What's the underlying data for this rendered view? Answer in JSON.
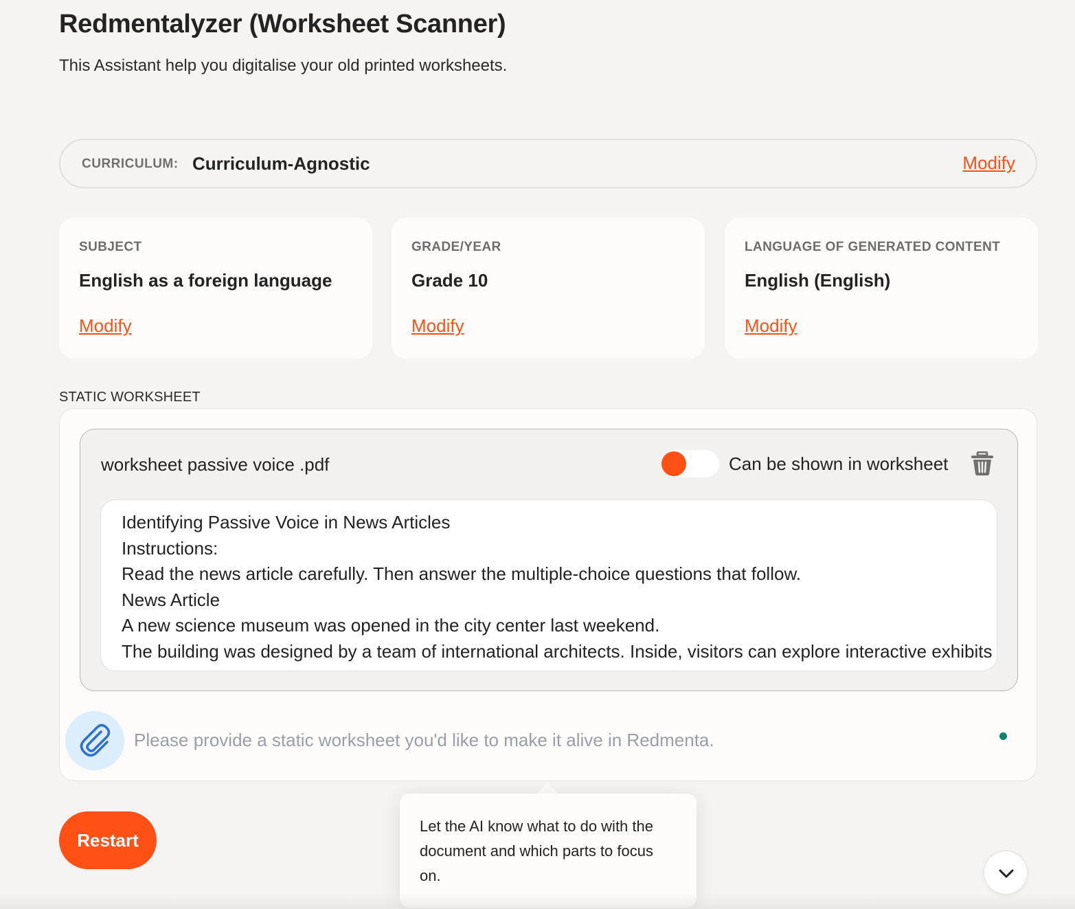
{
  "header": {
    "title": "Redmentalyzer (Worksheet Scanner)",
    "subtitle": "This Assistant help you digitalise your old printed worksheets."
  },
  "curriculum": {
    "label": "CURRICULUM:",
    "value": "Curriculum-Agnostic",
    "modify_label": "Modify"
  },
  "cards": [
    {
      "label": "SUBJECT",
      "value": "English as a foreign language",
      "modify_label": "Modify"
    },
    {
      "label": "GRADE/YEAR",
      "value": "Grade 10",
      "modify_label": "Modify"
    },
    {
      "label": "LANGUAGE OF GENERATED CONTENT",
      "value": "English (English)",
      "modify_label": "Modify"
    }
  ],
  "static_worksheet": {
    "section_label": "STATIC WORKSHEET",
    "file": {
      "name": "worksheet passive voice .pdf",
      "toggle_label": "Can be shown in worksheet",
      "toggle_on": true,
      "content_lines": [
        "Identifying Passive Voice in News Articles",
        "Instructions:",
        "Read the news article carefully. Then answer the multiple-choice questions that follow.",
        "News Article",
        "A new science museum was opened in the city center last weekend.",
        "The building was designed by a team of international architects. Inside, visitors can explore interactive exhibits"
      ]
    },
    "input_placeholder": "Please provide a static worksheet you'd like to make it alive in Redmenta.",
    "input_value": ""
  },
  "actions": {
    "restart_label": "Restart"
  },
  "tooltip": {
    "text": "Let the AI know what to do with the document and which parts to focus on."
  },
  "colors": {
    "accent": "#ff5016",
    "background": "#f5f4f2",
    "status_dot": "#14806c",
    "attach_bg": "#dcedfb"
  },
  "icons": {
    "trash": "trash-icon",
    "attach": "paperclip-icon",
    "scroll": "chevron-down-icon"
  }
}
